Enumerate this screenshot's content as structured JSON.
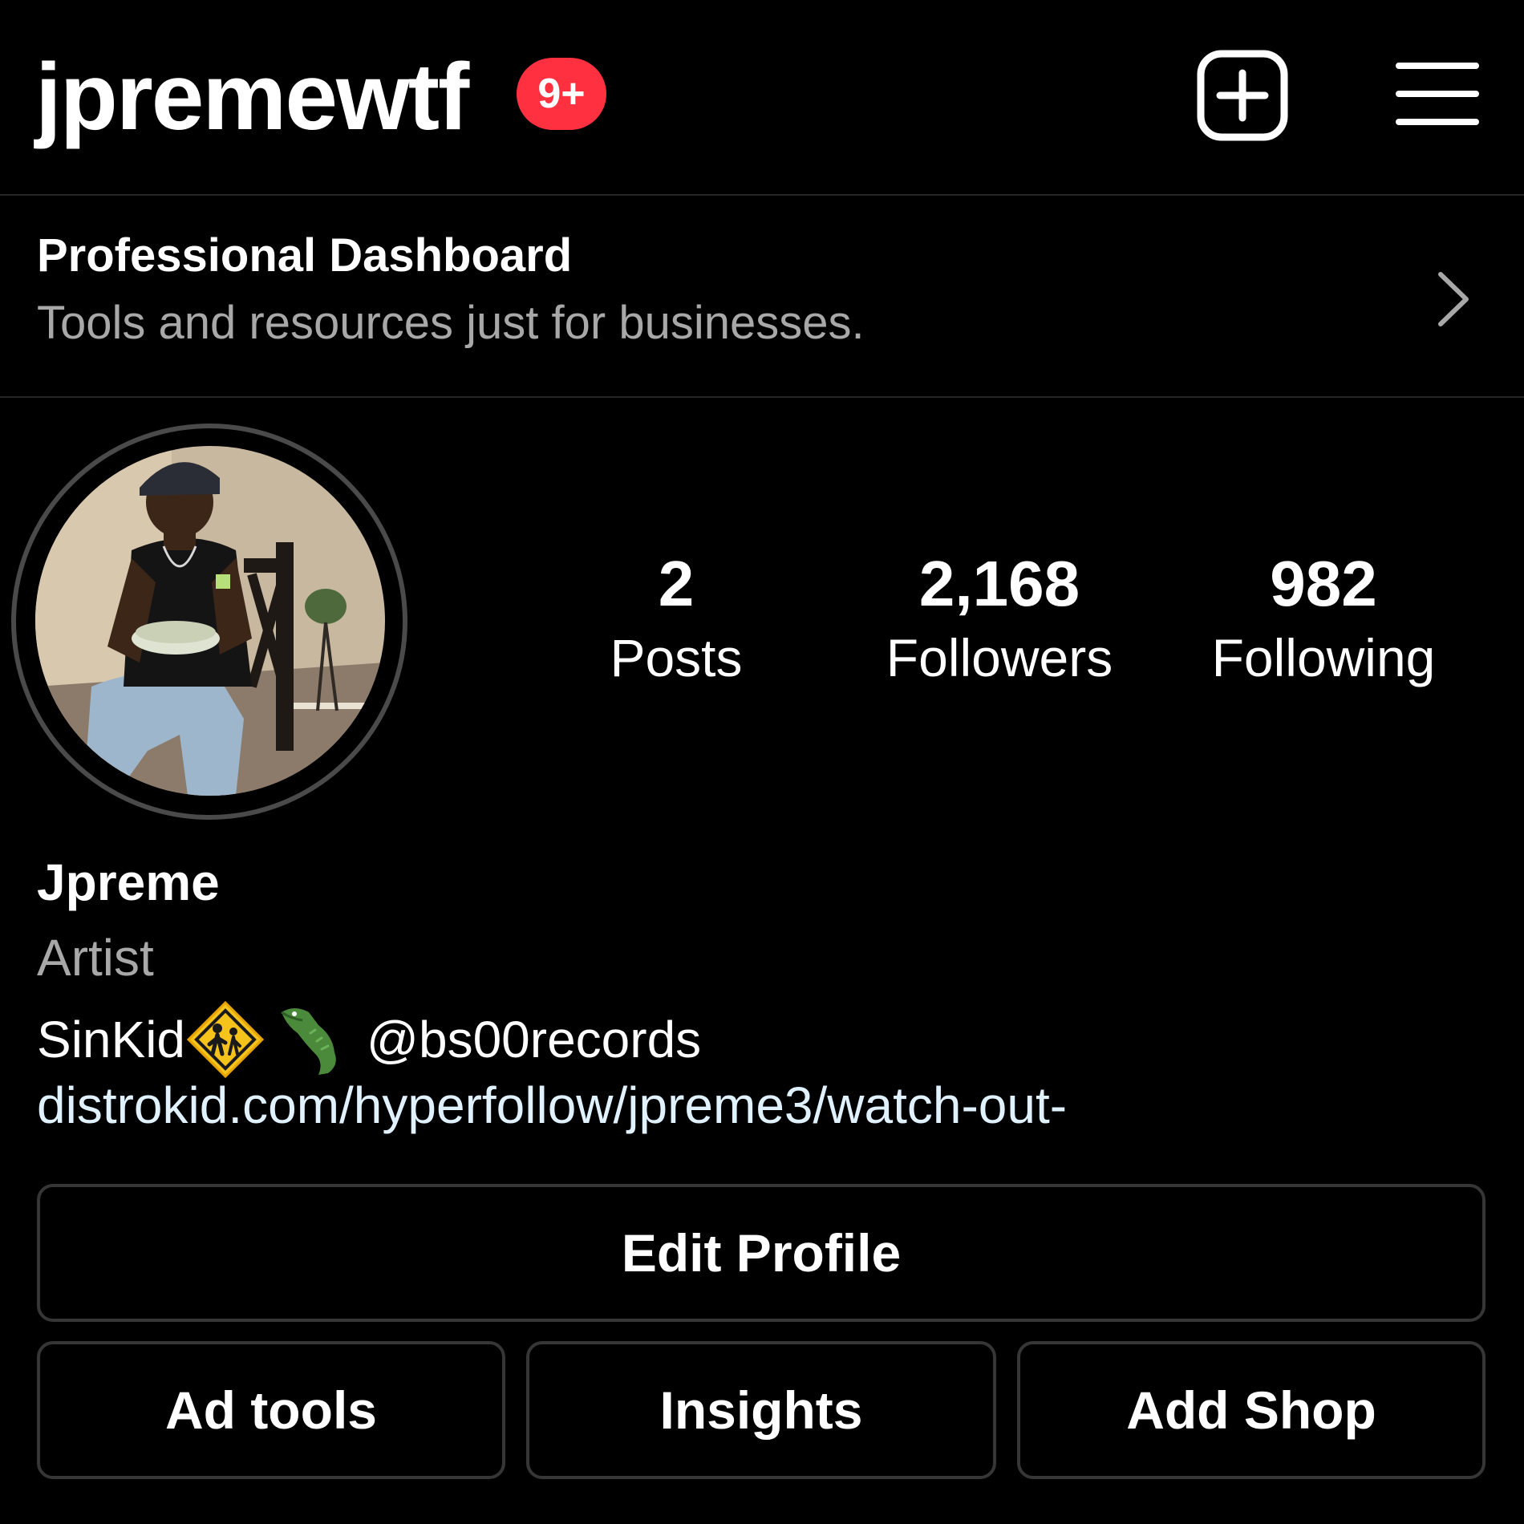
{
  "header": {
    "username": "jpremewtf",
    "notification_badge": "9+",
    "new_post_icon": "plus-square-icon",
    "menu_icon": "hamburger-menu-icon"
  },
  "dashboard": {
    "title": "Professional Dashboard",
    "subtitle": "Tools and resources just for businesses.",
    "chevron_icon": "chevron-right-icon"
  },
  "profile": {
    "stats": [
      {
        "value": "2",
        "label": "Posts"
      },
      {
        "value": "2,168",
        "label": "Followers"
      },
      {
        "value": "982",
        "label": "Following"
      }
    ],
    "display_name": "Jpreme",
    "category": "Artist",
    "bio": {
      "text": "SinKid",
      "emoji_1": "children-crossing-emoji",
      "emoji_2": "crocodile-emoji",
      "mention": "@bs00records"
    },
    "website": "distrokid.com/hyperfollow/jpreme3/watch-out-"
  },
  "buttons": {
    "edit_profile": "Edit Profile",
    "ad_tools": "Ad tools",
    "insights": "Insights",
    "add_shop": "Add Shop"
  },
  "colors": {
    "background": "#000000",
    "badge": "#ff3040",
    "secondary_text": "#a8a8a8",
    "link": "#e0f1ff",
    "button_border": "#363636",
    "divider": "#262626"
  }
}
